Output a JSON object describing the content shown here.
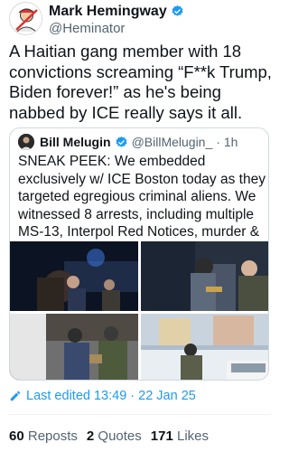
{
  "tweet": {
    "display_name": "Mark Hemingway",
    "handle": "@Heminator",
    "text": "A Haitian gang member with 18 convictions screaming “F**k Trump, Biden forever!” as he's being nabbed by ICE really says it all.",
    "verified_icon": "verified-badge-icon"
  },
  "quote": {
    "display_name": "Bill Melugin",
    "handle": "@BillMelugin_",
    "time": "· 1h",
    "text": "SNEAK PEEK: We embedded exclusively w/ ICE Boston today as they targeted egregious criminal aliens. We witnessed 8 arrests, including multiple MS-13, Interpol Red Notices, murder & rape suspects, &..."
  },
  "edited": {
    "label": "Last edited 13:49 · 22 Jan 25",
    "icon": "pencil-icon"
  },
  "stats": {
    "reposts_count": "60",
    "reposts_label": "Reposts",
    "quotes_count": "2",
    "quotes_label": "Quotes",
    "likes_count": "171",
    "likes_label": "Likes"
  },
  "colors": {
    "accent": "#1d9bf0",
    "secondary_text": "#536471",
    "border": "#cfd9de"
  }
}
